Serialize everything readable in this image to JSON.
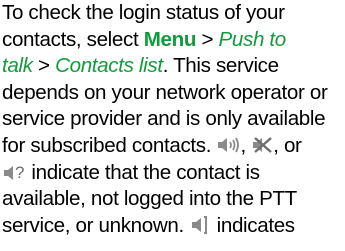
{
  "paragraph": {
    "l1": "To check the login status of your",
    "l2_pre": "contacts, select ",
    "menu_label": "Menu",
    "gt1": " > ",
    "push_to": "Push to",
    "talk": "talk",
    "gt2": " > ",
    "contacts_list": "Contacts list",
    "l3_post": ". This service",
    "l4": "depends on your network operator or",
    "l5": "service provider and is only available",
    "l6_pre": "for subscribed contacts. ",
    "l6_mid": ", ",
    "l6_post": ", or",
    "l7_post": " indicate that the contact is",
    "l8": "available, not logged into the PTT",
    "l9_pre": "service, or unknown. ",
    "l9_post": " indicates"
  },
  "icons": {
    "available": "speaker-sound-waves-icon",
    "not_logged_in": "speaker-crossed-icon",
    "unknown": "speaker-question-icon",
    "indicates": "speaker-bracket-icon"
  },
  "colors": {
    "link": "#129b3c",
    "icon_gray": "#8a8a8a"
  }
}
